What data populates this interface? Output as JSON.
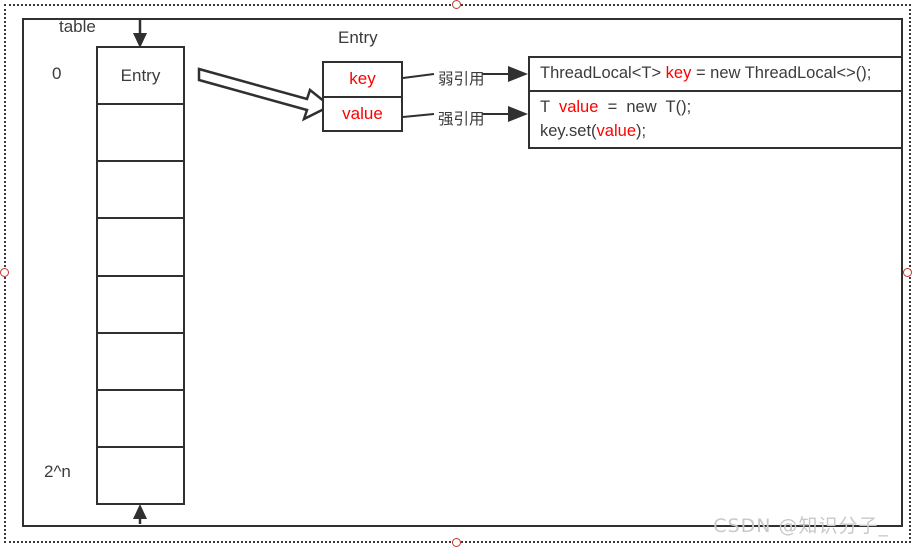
{
  "diagram": {
    "title": "ThreadLocal table / Entry weak-strong reference diagram",
    "table": {
      "pointer_label": "table",
      "first_index_label": "0",
      "last_index_label": "2^n",
      "cells": [
        {
          "text": "Entry"
        },
        {
          "text": ""
        },
        {
          "text": ""
        },
        {
          "text": ""
        },
        {
          "text": ""
        },
        {
          "text": ""
        },
        {
          "text": ""
        },
        {
          "text": ""
        }
      ]
    },
    "entry": {
      "title": "Entry",
      "key_label": "key",
      "value_label": "value"
    },
    "references": {
      "weak_label": "弱引用",
      "strong_label": "强引用"
    },
    "code": {
      "line1_part1": "ThreadLocal<T> ",
      "line1_key": "key",
      "line1_part2": " = new ThreadLocal<>();",
      "line2_part1": "T  ",
      "line2_value": "value",
      "line2_part2": "  =  new  T();",
      "line3_part1": "key.set(",
      "line3_value": "value",
      "line3_part2": ");"
    },
    "watermark": "CSDN @知识分子_",
    "colors": {
      "stroke": "#303030",
      "text": "#3b3b3b",
      "highlight": "#ff0000",
      "handle": "#c0392b",
      "watermark": "#c9c9c9"
    }
  }
}
